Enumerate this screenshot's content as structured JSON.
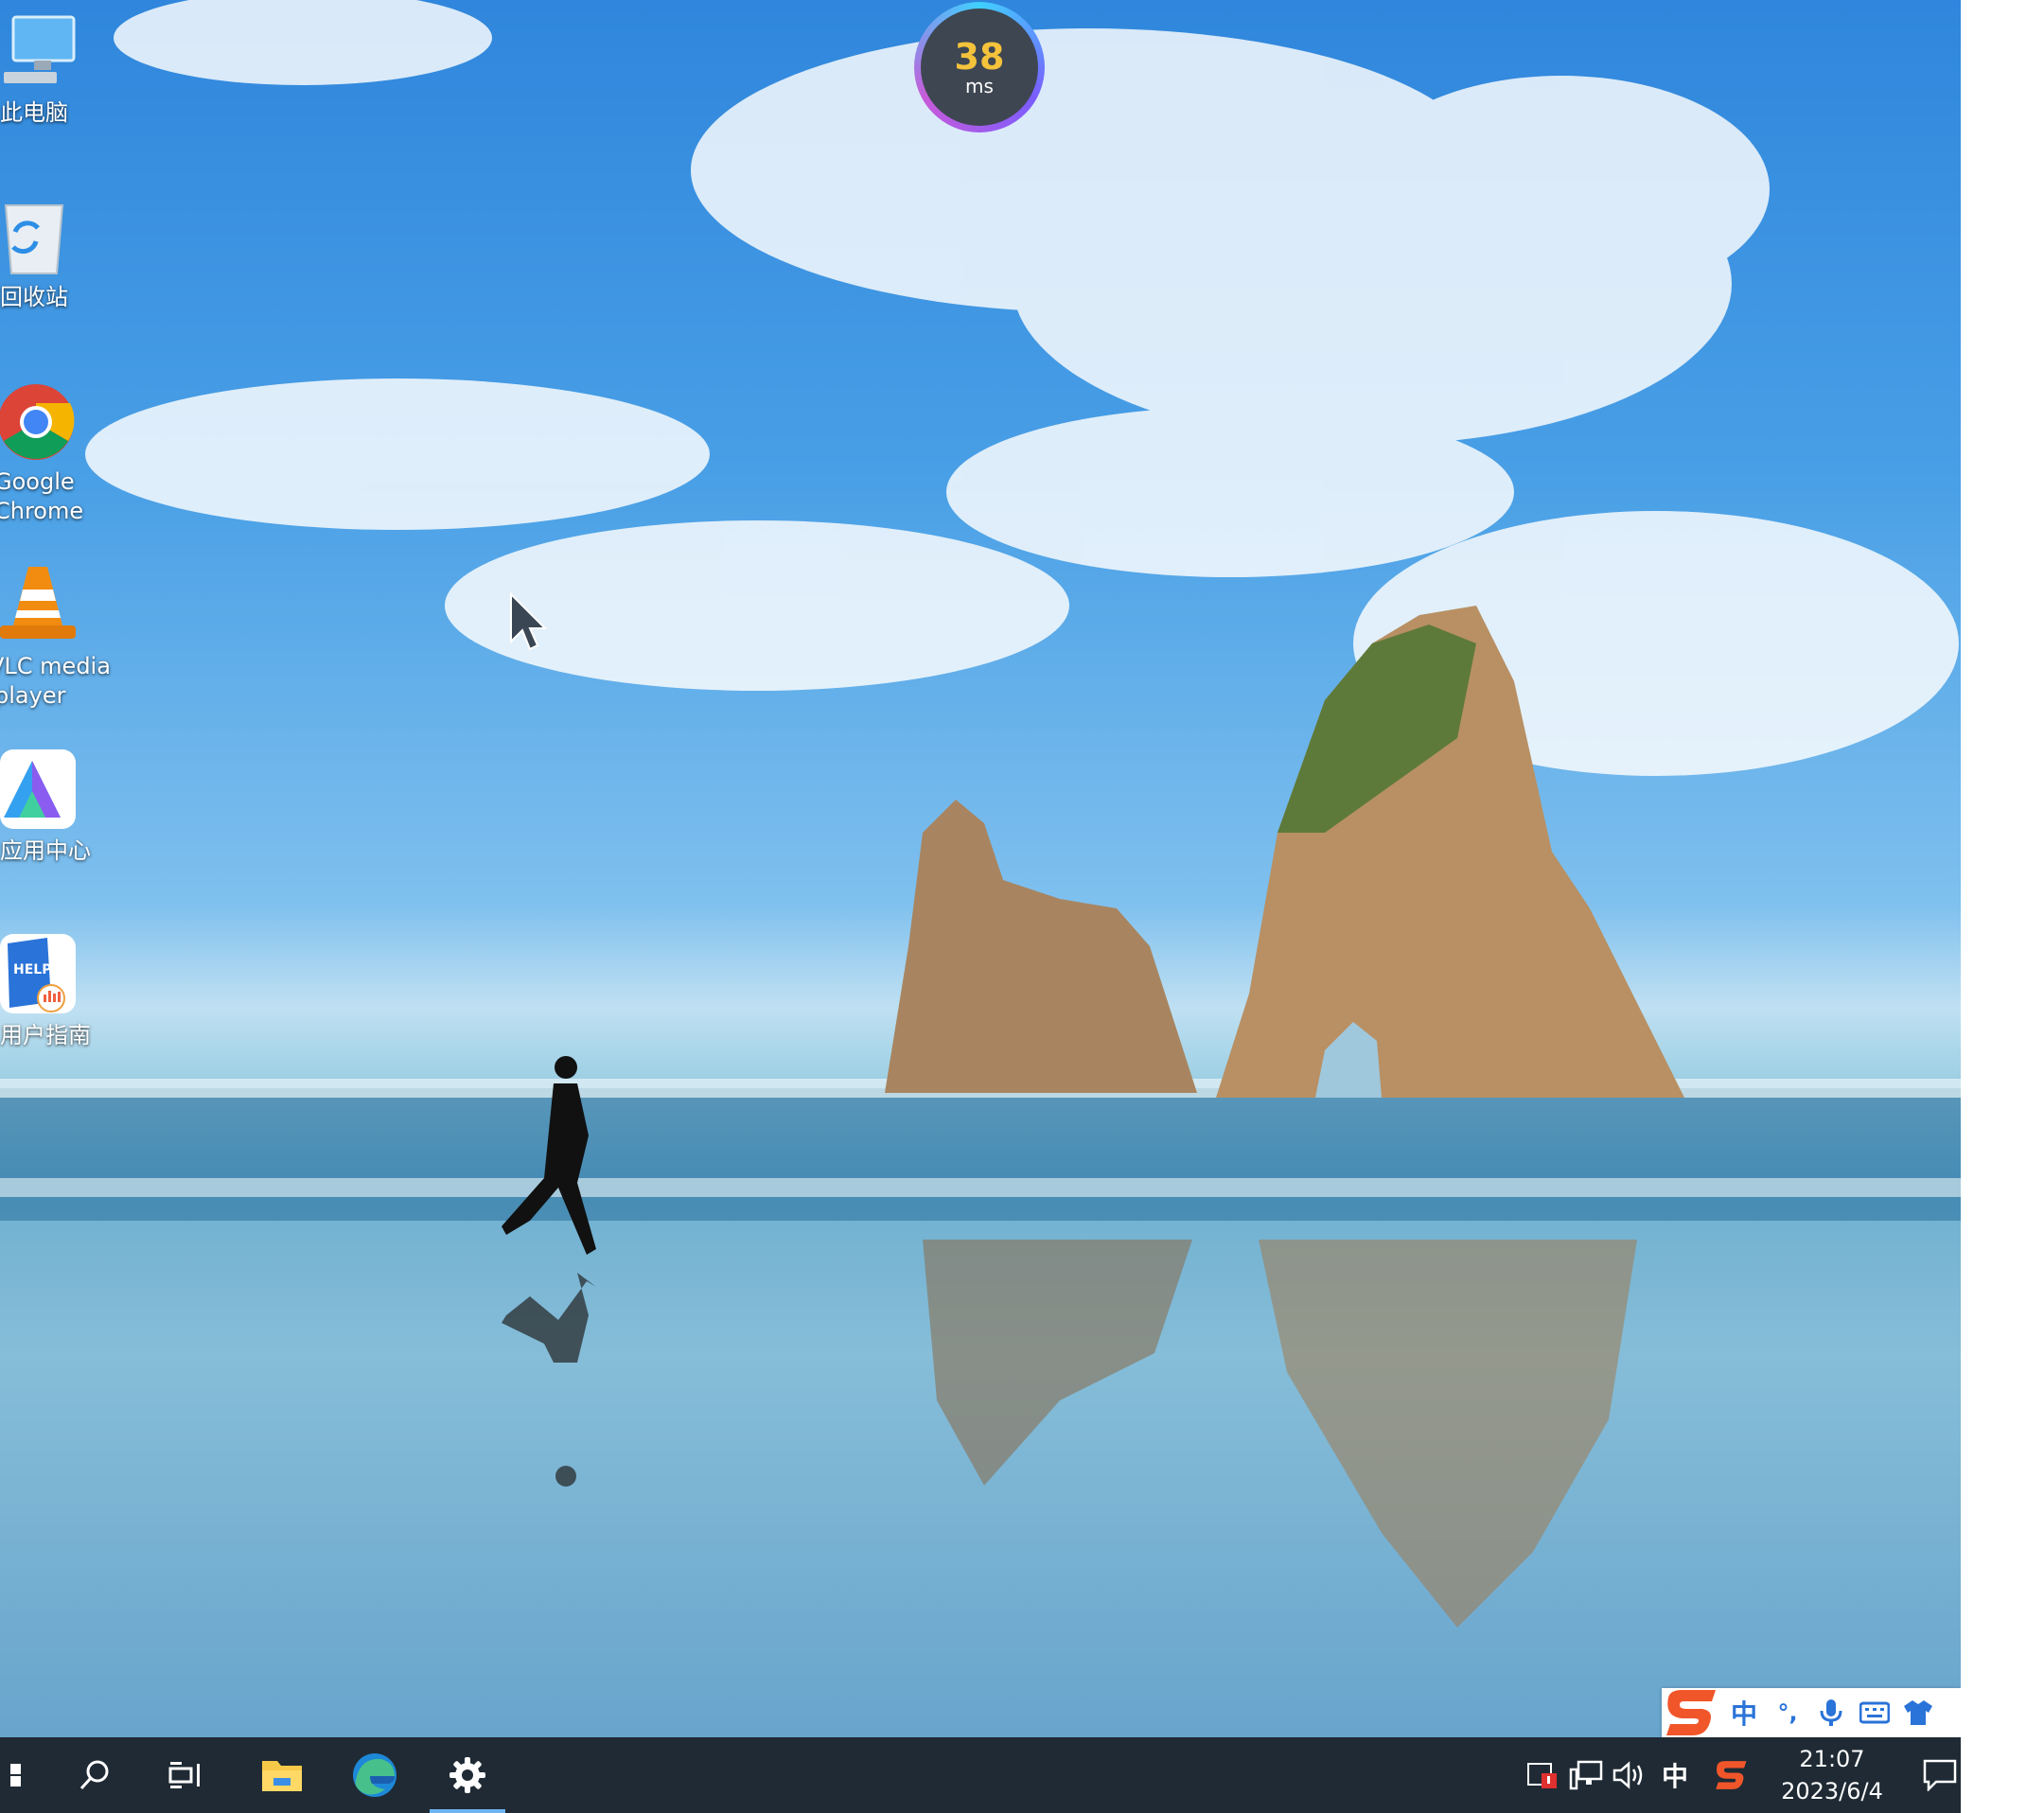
{
  "desktop": {
    "icons": [
      {
        "label": "此电脑",
        "icon": "computer-icon"
      },
      {
        "label": "回收站",
        "icon": "recycle-bin-icon"
      },
      {
        "label_line1": "Google",
        "label_line2": "Chrome",
        "icon": "chrome-icon"
      },
      {
        "label_line1": "VLC media",
        "label_line2": "player",
        "icon": "vlc-cone-icon"
      },
      {
        "label": "应用中心",
        "icon": "app-center-icon"
      },
      {
        "label": "用户指南",
        "icon": "help-book-icon"
      }
    ]
  },
  "ping_widget": {
    "value": "38",
    "unit": "ms"
  },
  "ime_toolbar": {
    "logo": "sogou-s-icon",
    "mode": "中",
    "punct": "°,",
    "items": [
      "microphone-icon",
      "keyboard-icon",
      "skin-shirt-icon"
    ]
  },
  "taskbar": {
    "pinned": [
      "windows-start-icon",
      "search-icon",
      "task-view-icon",
      "file-explorer-icon",
      "edge-icon",
      "settings-gear-icon"
    ],
    "active": "settings-gear-icon",
    "tray": {
      "ime_mode": "中",
      "time": "21:07",
      "date": "2023/6/4"
    }
  },
  "colors": {
    "taskbar": "#1f2a34",
    "accent": "#6db3f2",
    "ping_value": "#f4c23b",
    "ime_blue": "#2a73d8",
    "sogou_orange": "#f0562a"
  }
}
